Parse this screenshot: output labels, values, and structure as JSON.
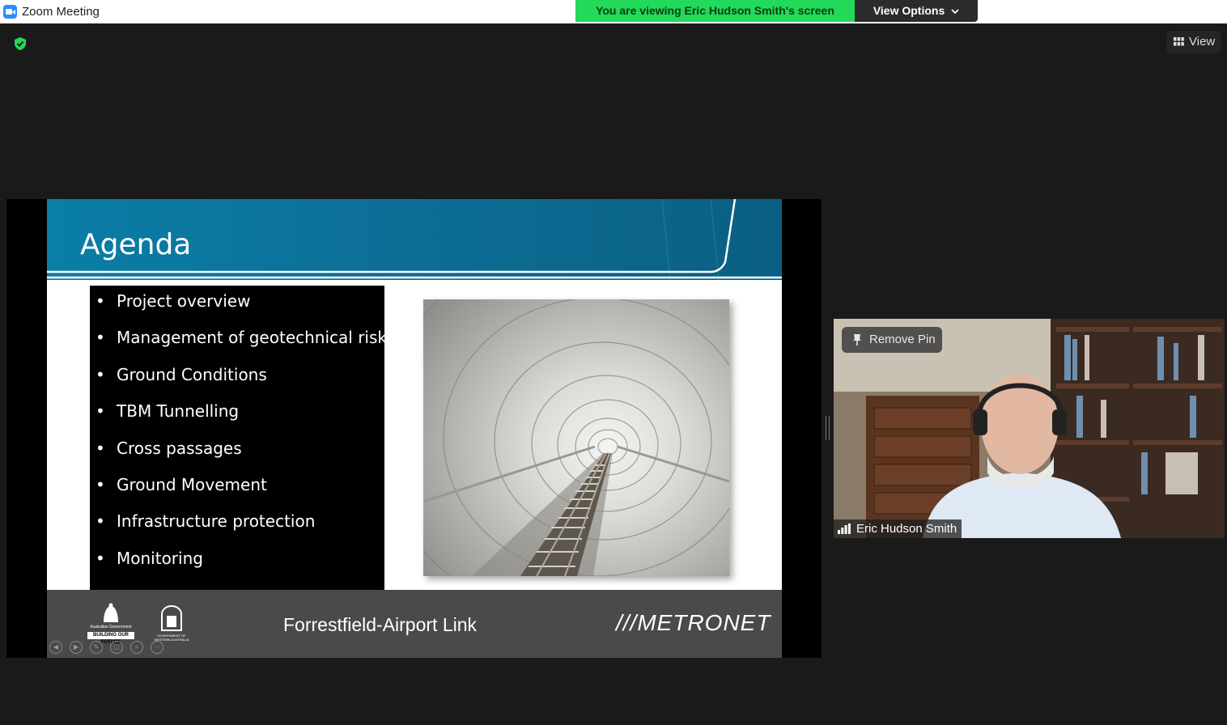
{
  "window": {
    "title": "Zoom Meeting"
  },
  "banner": {
    "text": "You are viewing Eric Hudson Smith's screen",
    "color": "#23d959"
  },
  "view_options": {
    "label": "View Options",
    "chevron": "⌄"
  },
  "security": {
    "icon": "shield-check-icon",
    "color": "#23d959"
  },
  "view_button": {
    "label": "View",
    "icon": "grid-icon"
  },
  "slide": {
    "title": "Agenda",
    "bullet": "•",
    "agenda": [
      "Project overview",
      "Management of geotechnical risk",
      "Ground Conditions",
      "TBM Tunnelling",
      "Cross passages",
      "Ground Movement",
      "Infrastructure protection",
      "Monitoring"
    ],
    "footer": {
      "title": "Forrestfield-Airport Link",
      "brand": "METRONET",
      "brand_mark": "///",
      "gov_federal": {
        "line1": "Australian Government",
        "line2": "BUILDING OUR FUTURE"
      },
      "gov_state": {
        "line1": "GOVERNMENT OF WESTERN AUSTRALIA"
      }
    },
    "header_color": "#0a7ea7",
    "footer_color": "#4a4a4c"
  },
  "presentation_controls": [
    "previous-icon",
    "next-icon",
    "pen-icon",
    "slides-icon",
    "zoom-icon",
    "more-icon"
  ],
  "participant": {
    "name": "Eric Hudson Smith",
    "pin_label": "Remove Pin"
  }
}
